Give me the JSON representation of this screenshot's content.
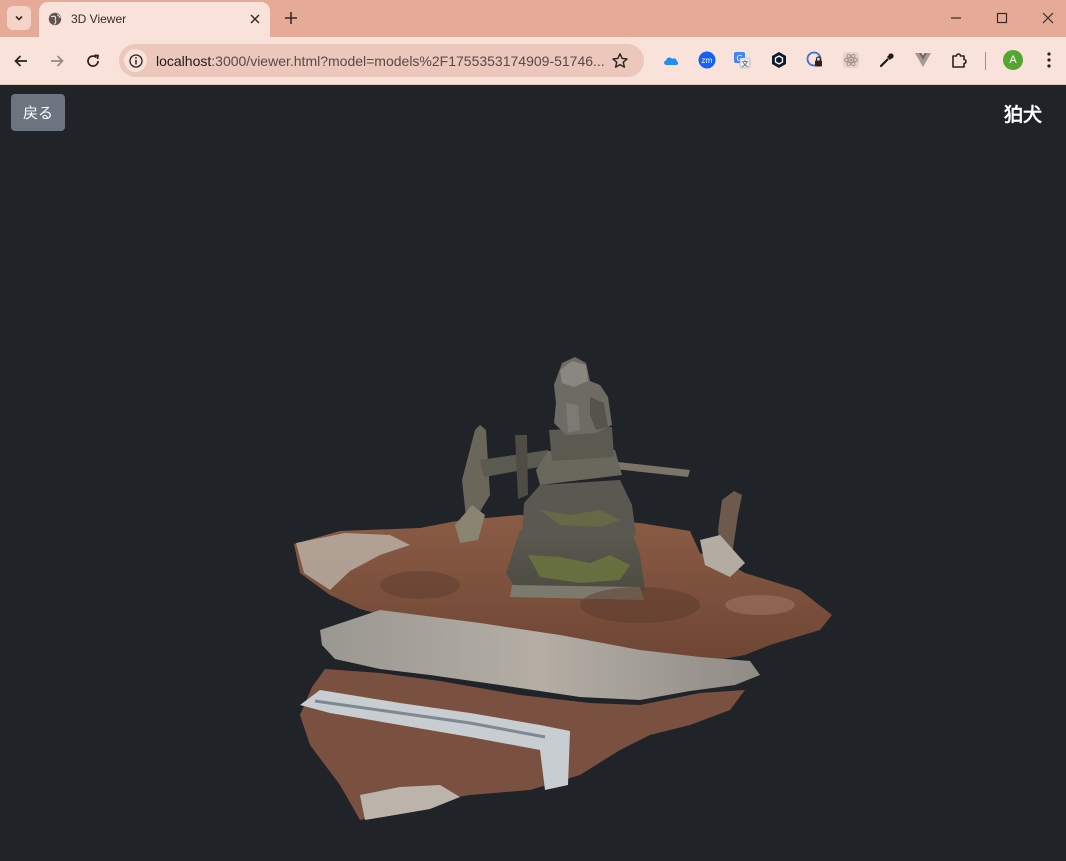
{
  "browser": {
    "tab_title": "3D Viewer",
    "url_host": "localhost",
    "url_rest": ":3000/viewer.html?model=models%2F1755353174909-51746...",
    "profile_initial": "A",
    "accent_color": "#e6ab97"
  },
  "page": {
    "back_label": "戻る",
    "model_title": "狛犬",
    "background_color": "#202328"
  }
}
